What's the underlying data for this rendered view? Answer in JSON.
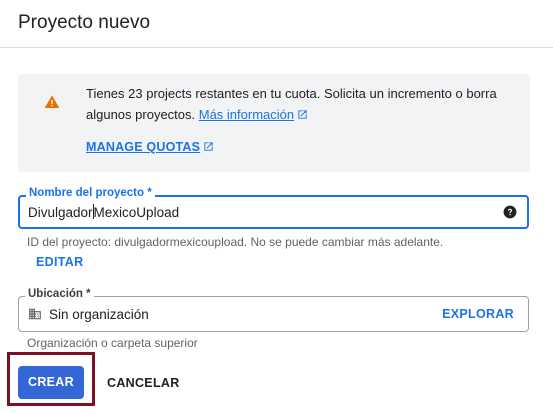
{
  "header": {
    "title": "Proyecto nuevo"
  },
  "warning": {
    "text": "Tienes 23 projects restantes en tu cuota. Solicita un incremento o borra algunos proyectos.",
    "more_info_link": "Más información",
    "manage_quotas_link": "MANAGE QUOTAS",
    "icon": "warning-icon",
    "accent_color": "#e37400"
  },
  "project_name": {
    "label": "Nombre del proyecto *",
    "value_before_caret": "Divulgador",
    "value_after_caret": "MexicoUpload",
    "hint": "ID del proyecto: divulgadormexicoupload. No se puede cambiar más adelante.",
    "edit_label": "EDITAR",
    "help_icon": "help-icon"
  },
  "location": {
    "label": "Ubicación *",
    "value": "Sin organización",
    "browse_label": "EXPLORAR",
    "hint": "Organización o carpeta superior",
    "icon": "building-icon"
  },
  "actions": {
    "create_label": "CREAR",
    "cancel_label": "CANCELAR"
  },
  "colors": {
    "primary": "#1a73e8",
    "create_button": "#3367d6",
    "highlight_border": "#7d1124"
  }
}
